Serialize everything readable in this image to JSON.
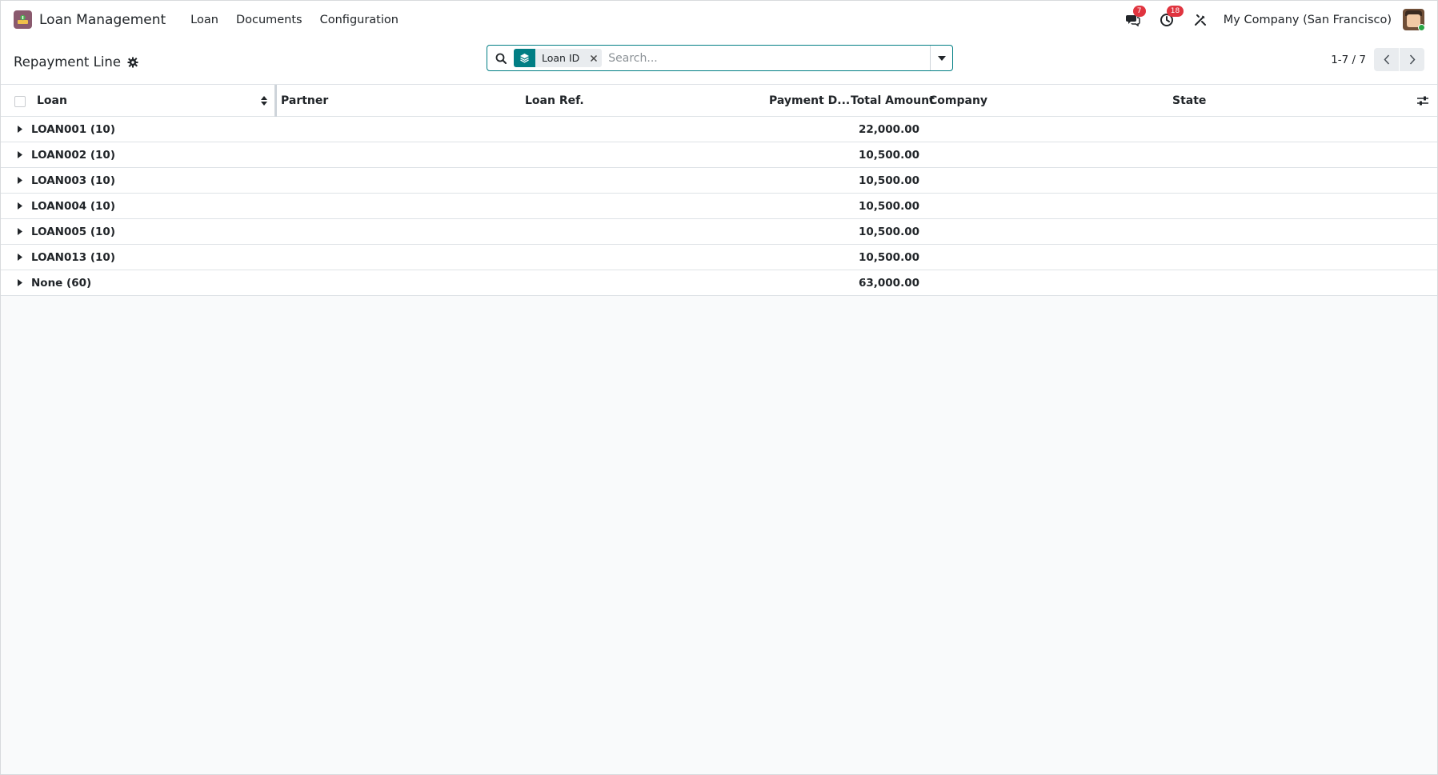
{
  "navbar": {
    "app_name": "Loan Management",
    "menu": [
      "Loan",
      "Documents",
      "Configuration"
    ],
    "messages_count": "7",
    "activities_count": "18",
    "company": "My Company (San Francisco)"
  },
  "control": {
    "breadcrumb": "Repayment Line",
    "search": {
      "facet_label": "Loan ID",
      "placeholder": "Search..."
    },
    "pager": "1-7 / 7"
  },
  "table": {
    "columns": {
      "loan": "Loan",
      "partner": "Partner",
      "loan_ref": "Loan Ref.",
      "payment_date": "Payment D...",
      "total_amount": "Total Amount",
      "company": "Company",
      "state": "State"
    },
    "groups": [
      {
        "label": "LOAN001 (10)",
        "total": "22,000.00"
      },
      {
        "label": "LOAN002 (10)",
        "total": "10,500.00"
      },
      {
        "label": "LOAN003 (10)",
        "total": "10,500.00"
      },
      {
        "label": "LOAN004 (10)",
        "total": "10,500.00"
      },
      {
        "label": "LOAN005 (10)",
        "total": "10,500.00"
      },
      {
        "label": "LOAN013 (10)",
        "total": "10,500.00"
      },
      {
        "label": "None (60)",
        "total": "63,000.00"
      }
    ]
  },
  "colors": {
    "accent": "#017e84",
    "badge": "#e0343f",
    "app_icon": "#8a5a6e"
  }
}
